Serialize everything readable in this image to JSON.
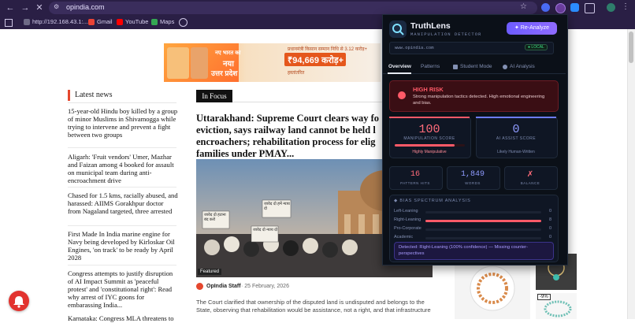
{
  "browser": {
    "url": "opindia.com",
    "bookmarks": [
      {
        "label": "http://192.168.43.1:...",
        "icon": "globe-icon"
      },
      {
        "label": "Gmail",
        "icon": "gmail-icon"
      },
      {
        "label": "YouTube",
        "icon": "youtube-icon"
      },
      {
        "label": "Maps",
        "icon": "maps-icon"
      }
    ]
  },
  "page": {
    "latest_news_title": "Latest news",
    "news": [
      "15-year-old Hindu boy killed by a group of minor Muslims in Shivamogga while trying to intervene and prevent a fight between two groups",
      "Aligarh: 'Fruit vendors' Umer, Mazhar and Faizan among 4 booked for assault on municipal team during anti-encroachment drive",
      "Chased for 1.5 kms, racially abused, and harassed: AIIMS Gorakhpur doctor from Nagaland targeted, three arrested",
      "First Made In India marine engine for Navy being developed by Kirloskar Oil Engines, 'on track' to be ready by April 2028",
      "Congress attempts to justify disruption of AI Impact Summit as 'peaceful protest' and 'constitutional right': Read why arrest of IYC goons for embarassing India...",
      "Karnataka: Congress MLA threatens to"
    ],
    "in_focus_label": "In Focus",
    "headline": "Uttarakhand: Supreme Court clears way fo eviction, says railway land cannot be held l encroachers; rehabilitation process for elig families under PMAY...",
    "featured_label": "Featured",
    "author": "OpIndia Staff",
    "date": "· 25 February, 2026",
    "excerpt": "The Court clarified that ownership of the disputed land is undisputed and belongs to the State, observing that rehabilitation would be assistance, not a right, and that infrastructure",
    "discount_badge": "-9%",
    "ad_text_1": "प्रधानमंत्री किसान सम्मान निधि से 3.12 करोड़+",
    "ad_amount": "₹94,669 करोड़+",
    "ad_text_2": "हस्तांतरित",
    "ad_left_text_1": "नए भारत का",
    "ad_left_text_2": "नया",
    "ad_left_text_3": "उत्तर प्रदेश",
    "hero_signs": [
      "जावेद दो हटाना बंद करो",
      "जावेद दो हमें न्याय दो",
      "जावेद दो न्याय दो"
    ]
  },
  "popup": {
    "brand": "TruthLens",
    "subtitle": "MANIPULATION DETECTOR",
    "reanalyze_label": "✦ Re-Analyze",
    "domain": "www.opindia.com",
    "mode_badge": "● LOCAL",
    "tabs": [
      {
        "label": "Overview",
        "active": true
      },
      {
        "label": "Patterns",
        "active": false
      },
      {
        "label": "Student Mode",
        "active": false
      },
      {
        "label": "AI Analysis",
        "active": false
      }
    ],
    "risk": {
      "title": "HIGH RISK",
      "description": "Strong manipulation tactics detected. High emotional engineering and bias."
    },
    "manipulation": {
      "score": "100",
      "label": "MANIPULATION SCORE",
      "sub": "Highly Manipulative",
      "level": 0.85
    },
    "ai_assist": {
      "score": "0",
      "label": "AI ASSIST SCORE",
      "sub": "Likely Human-Written"
    },
    "stats": [
      {
        "value": "16",
        "label": "PATTERN HITS",
        "color": "#ff6b7a"
      },
      {
        "value": "1,849",
        "label": "WORDS",
        "color": "#8f9bff"
      },
      {
        "value": "✗",
        "label": "BALANCE",
        "color": "#ff6b7a"
      }
    ],
    "bias": {
      "title": "◆ BIAS SPECTRUM ANALYSIS",
      "rows": [
        {
          "label": "Left-Leaning",
          "value": "0",
          "fraction": 0
        },
        {
          "label": "Right-Leaning",
          "value": "8",
          "fraction": 1
        },
        {
          "label": "Pro-Corporate",
          "value": "0",
          "fraction": 0
        },
        {
          "label": "Academic",
          "value": "0",
          "fraction": 0
        }
      ],
      "detected": "Detected: Right-Leaning (100% confidence) — Missing counter-perspectives"
    }
  }
}
